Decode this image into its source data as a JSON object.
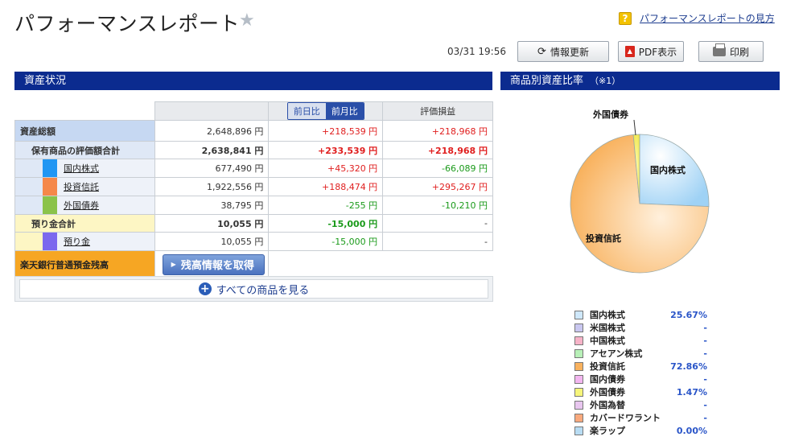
{
  "header": {
    "title": "パフォーマンスレポート",
    "help_link": "パフォーマンスレポートの見方",
    "help_icon": "?",
    "timestamp": "03/31 19:56",
    "refresh_label": "情報更新",
    "pdf_label": "PDF表示",
    "print_label": "印刷"
  },
  "assets_section": {
    "title": "資産状況",
    "toggle": {
      "day": "前日比",
      "month": "前月比"
    },
    "eval_header": "評価損益",
    "total": {
      "label": "資産総額",
      "value": "2,648,896 円",
      "change": "+218,539 円",
      "eval": "+218,968 円"
    },
    "holdings": {
      "label": "保有商品の評価額合計",
      "value": "2,638,841 円",
      "change": "+233,539 円",
      "eval": "+218,968 円"
    },
    "items": [
      {
        "label": "国内株式",
        "value": "677,490 円",
        "change": "+45,320 円",
        "eval": "-66,089 円",
        "color": "#2196f3"
      },
      {
        "label": "投資信託",
        "value": "1,922,556 円",
        "change": "+188,474 円",
        "eval": "+295,267 円",
        "color": "#f5884a"
      },
      {
        "label": "外国債券",
        "value": "38,795 円",
        "change": "-255 円",
        "eval": "-10,210 円",
        "color": "#8bc34a"
      }
    ],
    "deposit_total": {
      "label": "預り金合計",
      "value": "10,055 円",
      "change": "-15,000 円",
      "eval": "-"
    },
    "deposit": {
      "label": "預り金",
      "value": "10,055 円",
      "change": "-15,000 円",
      "eval": "-",
      "color": "#7b68ee"
    },
    "rakuten": {
      "label": "楽天銀行普通預金残高",
      "button": "残高情報を取得"
    },
    "all_products": "すべての商品を見る"
  },
  "ratio_section": {
    "title": "商品別資産比率",
    "note": "（※1）",
    "pie_labels": {
      "domestic": "国内株式",
      "fund": "投資信託",
      "foreign_bond": "外国債券"
    },
    "legend": [
      {
        "name": "国内株式",
        "value": "25.67%",
        "color": "#cfe8fb"
      },
      {
        "name": "米国株式",
        "value": "-",
        "color": "#c9c7f0"
      },
      {
        "name": "中国株式",
        "value": "-",
        "color": "#f7b3c8"
      },
      {
        "name": "アセアン株式",
        "value": "-",
        "color": "#b8f0b8"
      },
      {
        "name": "投資信託",
        "value": "72.86%",
        "color": "#f9b25e"
      },
      {
        "name": "国内債券",
        "value": "-",
        "color": "#f3b6f0"
      },
      {
        "name": "外国債券",
        "value": "1.47%",
        "color": "#f6f57a"
      },
      {
        "name": "外国為替",
        "value": "-",
        "color": "#e8c6ef"
      },
      {
        "name": "カバードワラント",
        "value": "-",
        "color": "#f9a97d"
      },
      {
        "name": "楽ラップ",
        "value": "0.00%",
        "color": "#b8dcf3"
      }
    ]
  },
  "chart_data": {
    "type": "pie",
    "categories": [
      "国内株式",
      "投資信託",
      "外国債券"
    ],
    "values": [
      25.67,
      72.86,
      1.47
    ]
  }
}
